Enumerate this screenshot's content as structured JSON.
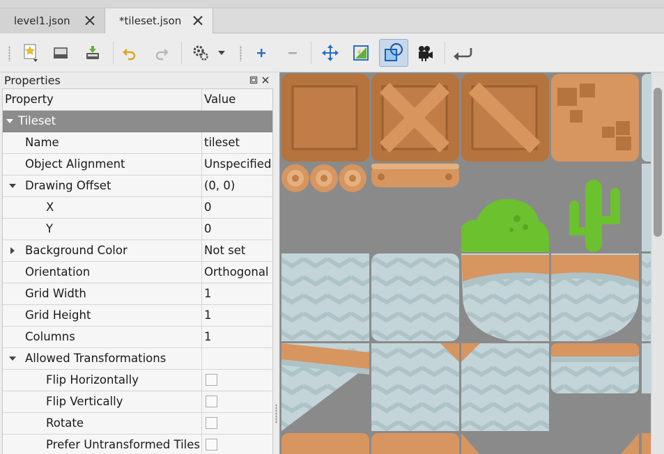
{
  "tabs": [
    {
      "label": "level1.json",
      "active": false
    },
    {
      "label": "*tileset.json",
      "active": true
    }
  ],
  "toolbar": {
    "buttons": [
      {
        "icon": "new-document-icon"
      },
      {
        "icon": "open-folder-icon"
      },
      {
        "icon": "save-icon"
      },
      {
        "icon": "undo-icon"
      },
      {
        "icon": "redo-icon"
      },
      {
        "icon": "tileset-properties-icon"
      },
      {
        "icon": "add-tiles-icon"
      },
      {
        "icon": "remove-tiles-icon"
      },
      {
        "icon": "rearrange-tiles-icon"
      },
      {
        "icon": "edit-terrain-icon"
      },
      {
        "icon": "edit-collision-icon",
        "active": true
      },
      {
        "icon": "tile-animation-icon"
      },
      {
        "icon": "dynamic-wrapping-icon"
      }
    ]
  },
  "properties_panel": {
    "title": "Properties",
    "header": {
      "property": "Property",
      "value": "Value"
    },
    "group": "Tileset",
    "rows": [
      {
        "label": "Name",
        "value": "tileset"
      },
      {
        "label": "Object Alignment",
        "value": "Unspecified"
      },
      {
        "label": "Drawing Offset",
        "value": "(0, 0)"
      },
      {
        "label": "X",
        "value": "0"
      },
      {
        "label": "Y",
        "value": "0"
      },
      {
        "label": "Background Color",
        "value": "Not set"
      },
      {
        "label": "Orientation",
        "value": "Orthogonal"
      },
      {
        "label": "Grid Width",
        "value": "1"
      },
      {
        "label": "Grid Height",
        "value": "1"
      },
      {
        "label": "Columns",
        "value": "1"
      },
      {
        "label": "Allowed Transformations",
        "value": ""
      },
      {
        "label": "Flip Horizontally",
        "checked": false
      },
      {
        "label": "Flip Vertically",
        "checked": false
      },
      {
        "label": "Rotate",
        "checked": false
      },
      {
        "label": "Prefer Untransformed Tiles",
        "checked": false
      }
    ]
  },
  "colors": {
    "crate": "#b5733e",
    "crate_light": "#d9955e",
    "dirt": "#d7955f",
    "grass_green": "#6cc12e",
    "ice": "#c3d5d9",
    "tile_bg": "#8a8a8a",
    "group_header": "#8c8c8c"
  }
}
